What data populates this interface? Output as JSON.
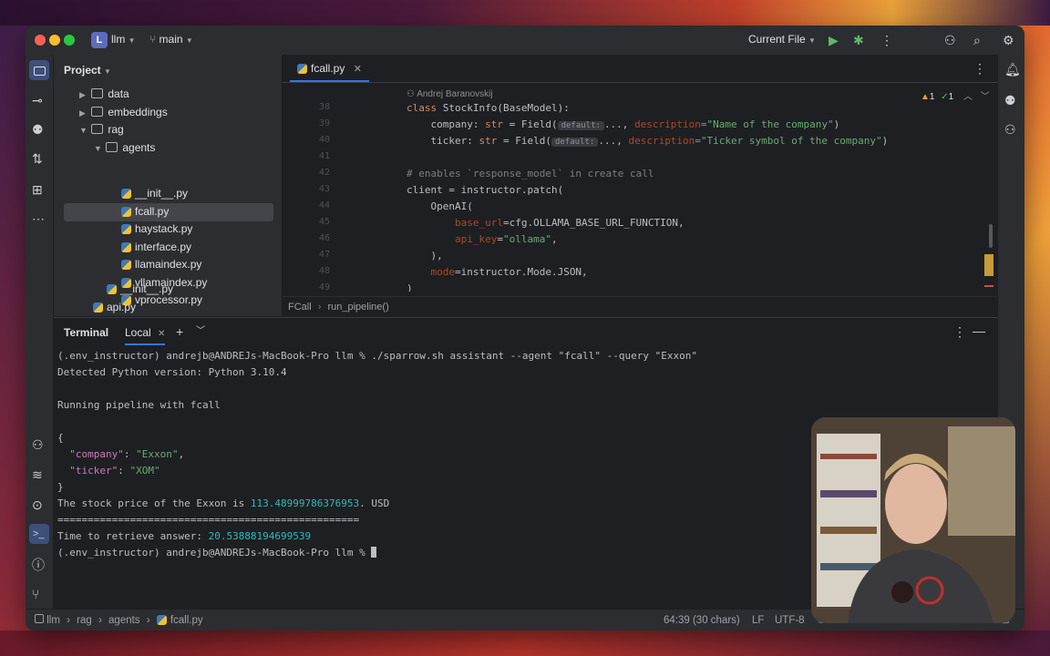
{
  "titlebar": {
    "project_badge": "L",
    "project_name": "llm",
    "branch": "main",
    "run_config": "Current File"
  },
  "project_panel": {
    "title": "Project",
    "tree": [
      {
        "label": "data",
        "type": "folder",
        "expanded": false
      },
      {
        "label": "embeddings",
        "type": "folder",
        "expanded": false
      },
      {
        "label": "rag",
        "type": "folder",
        "expanded": true
      },
      {
        "label": "agents",
        "type": "folder",
        "expanded": true
      },
      {
        "label": "__init__.py",
        "type": "py"
      },
      {
        "label": "fcall.py",
        "type": "py",
        "selected": true
      },
      {
        "label": "haystack.py",
        "type": "py"
      },
      {
        "label": "interface.py",
        "type": "py"
      },
      {
        "label": "llamaindex.py",
        "type": "py"
      },
      {
        "label": "vllamaindex.py",
        "type": "py"
      },
      {
        "label": "vprocessor.py",
        "type": "py"
      },
      {
        "label": "__init__.py",
        "type": "py"
      },
      {
        "label": "api.py",
        "type": "py"
      }
    ]
  },
  "editor": {
    "tab_label": "fcall.py",
    "author": "Andrej Baranovskij",
    "inspections": {
      "warnings": "1",
      "ok": "1"
    },
    "line_numbers": [
      "38",
      "39",
      "40",
      "41",
      "42",
      "43",
      "44",
      "45",
      "46",
      "47",
      "48",
      "49"
    ],
    "breadcrumb": [
      "FCall",
      "run_pipeline()"
    ],
    "hint_default": "default:",
    "code": {
      "l38_kw": "class ",
      "l38_rest": "StockInfo(BaseModel):",
      "l39_a": "    company: ",
      "l39_type": "str",
      "l39_b": " = Field(",
      "l39_c": "..., ",
      "l39_p": "description",
      "l39_s": "=\"Name of the company\"",
      "l39_e": ")",
      "l40_a": "    ticker: ",
      "l40_type": "str",
      "l40_b": " = Field(",
      "l40_c": "..., ",
      "l40_p": "description",
      "l40_s": "=\"Ticker symbol of the company\"",
      "l40_e": ")",
      "l42": "# enables `response_model` in create call",
      "l43": "client = instructor.patch(",
      "l44": "    OpenAI(",
      "l45_p": "        base_url",
      "l45_r": "=cfg.OLLAMA_BASE_URL_FUNCTION,",
      "l46_p": "        api_key",
      "l46_eq": "=",
      "l46_s": "\"ollama\"",
      "l46_c": ",",
      "l47": "    ),",
      "l48_p": "    mode",
      "l48_r": "=instructor.Mode.JSON,",
      "l49": ")"
    }
  },
  "terminal": {
    "title": "Terminal",
    "tab": "Local",
    "lines": {
      "cmd": "(.env_instructor) andrejb@ANDREJs-MacBook-Pro llm % ./sparrow.sh assistant --agent \"fcall\" --query \"Exxon\"",
      "pyver": "Detected Python version: Python 3.10.4",
      "running": "Running pipeline with fcall",
      "open": "{",
      "k1": "\"company\"",
      "v1": "\"Exxon\"",
      "k2": "\"ticker\"",
      "v2": "\"XOM\"",
      "close": "}",
      "price_pre": "The stock price of the Exxon is ",
      "price": "113.48999786376953",
      "price_post": ". USD",
      "sep": "==================================================",
      "time_pre": "Time to retrieve answer: ",
      "time": "20.53888194699539",
      "prompt": "(.env_instructor) andrejb@ANDREJs-MacBook-Pro llm % "
    }
  },
  "statusbar": {
    "path": [
      "llm",
      "rag",
      "agents",
      "fcall.py"
    ],
    "position": "64:39 (30 chars)",
    "line_sep": "LF",
    "encoding": "UTF-8"
  }
}
